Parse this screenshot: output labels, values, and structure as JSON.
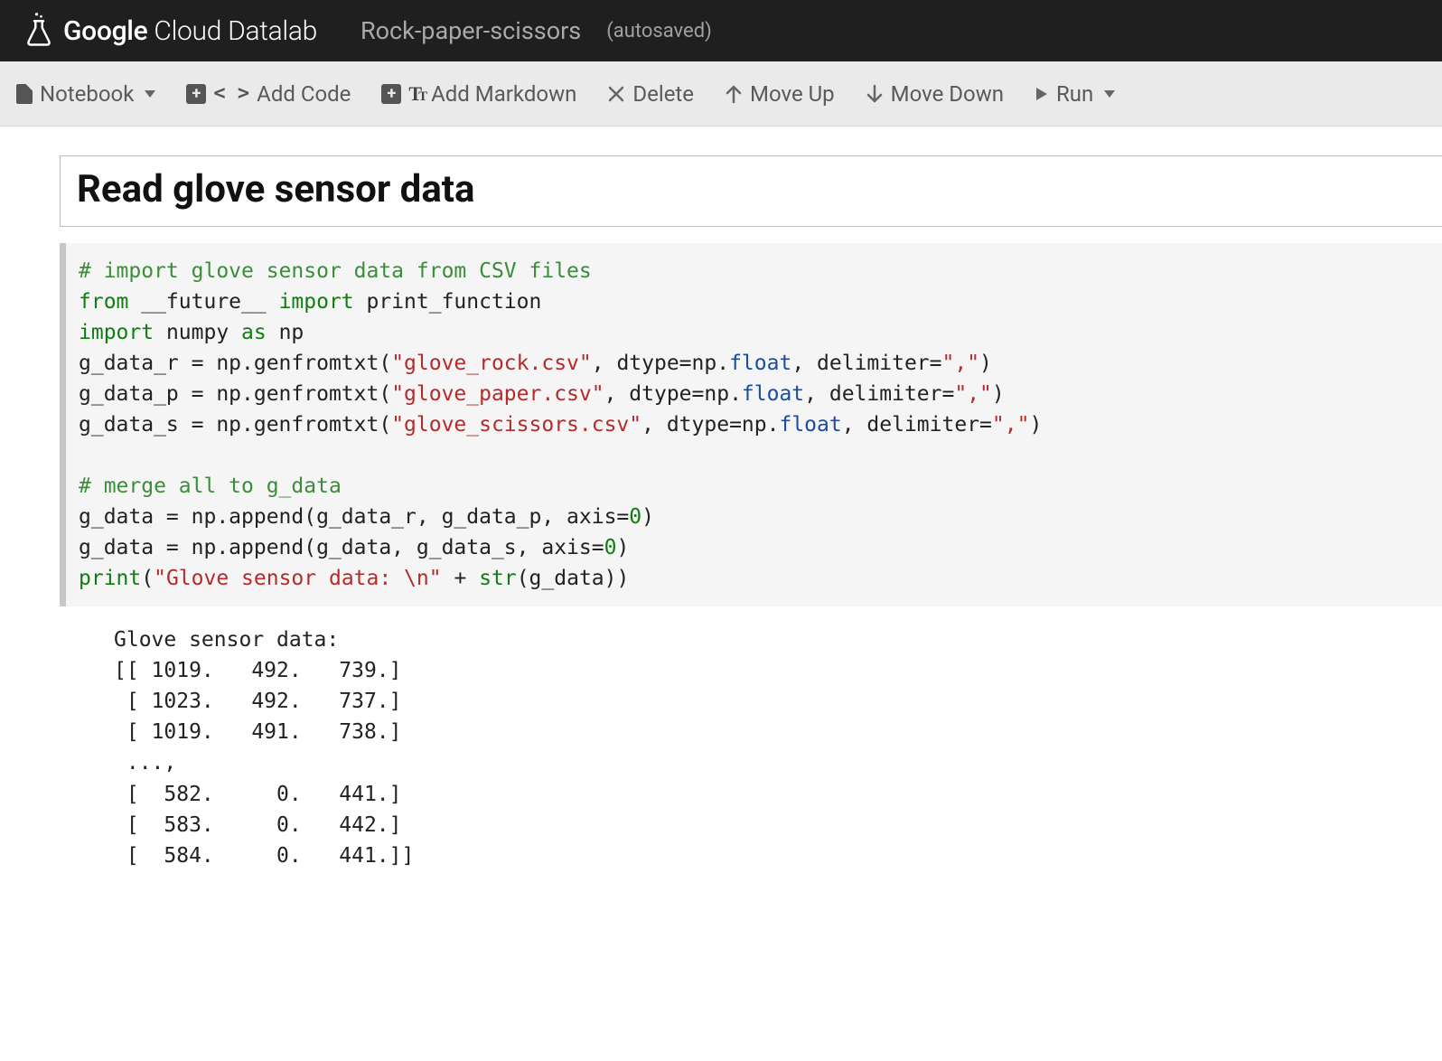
{
  "header": {
    "brand_strong": "Google",
    "brand_light": " Cloud Datalab",
    "notebook_title": "Rock-paper-scissors",
    "autosaved": "(autosaved)"
  },
  "toolbar": {
    "notebook": "Notebook",
    "add_code": "Add Code",
    "add_markdown": "Add Markdown",
    "delete": "Delete",
    "move_up": "Move Up",
    "move_down": "Move Down",
    "run": "Run"
  },
  "cells": {
    "markdown_heading": "Read glove sensor data",
    "code_lines": [
      {
        "t": "comment",
        "v": "# import glove sensor data from CSV files"
      },
      {
        "t": "raw",
        "v": "<span class='c-kw'>from</span> __future__ <span class='c-kw'>import</span> print_function"
      },
      {
        "t": "raw",
        "v": "<span class='c-kw'>import</span> numpy <span class='c-kw'>as</span> np"
      },
      {
        "t": "raw",
        "v": "g_data_r = np.genfromtxt(<span class='c-str'>\"glove_rock.csv\"</span>, dtype=np.<span class='c-attr'>float</span>, delimiter=<span class='c-str'>\",\"</span>)"
      },
      {
        "t": "raw",
        "v": "g_data_p = np.genfromtxt(<span class='c-str'>\"glove_paper.csv\"</span>, dtype=np.<span class='c-attr'>float</span>, delimiter=<span class='c-str'>\",\"</span>)"
      },
      {
        "t": "raw",
        "v": "g_data_s = np.genfromtxt(<span class='c-str'>\"glove_scissors.csv\"</span>, dtype=np.<span class='c-attr'>float</span>, delimiter=<span class='c-str'>\",\"</span>)"
      },
      {
        "t": "blank",
        "v": ""
      },
      {
        "t": "comment",
        "v": "# merge all to g_data"
      },
      {
        "t": "raw",
        "v": "g_data = np.append(g_data_r, g_data_p, axis=<span class='c-num'>0</span>)"
      },
      {
        "t": "raw",
        "v": "g_data = np.append(g_data, g_data_s, axis=<span class='c-num'>0</span>)"
      },
      {
        "t": "raw",
        "v": "<span class='c-builtin'>print</span>(<span class='c-str'>\"Glove sensor data: \\n\"</span> + <span class='c-builtin'>str</span>(g_data))"
      }
    ],
    "output_text": "Glove sensor data: \n[[ 1019.   492.   739.]\n [ 1023.   492.   737.]\n [ 1019.   491.   738.]\n ..., \n [  582.     0.   441.]\n [  583.     0.   442.]\n [  584.     0.   441.]]"
  }
}
